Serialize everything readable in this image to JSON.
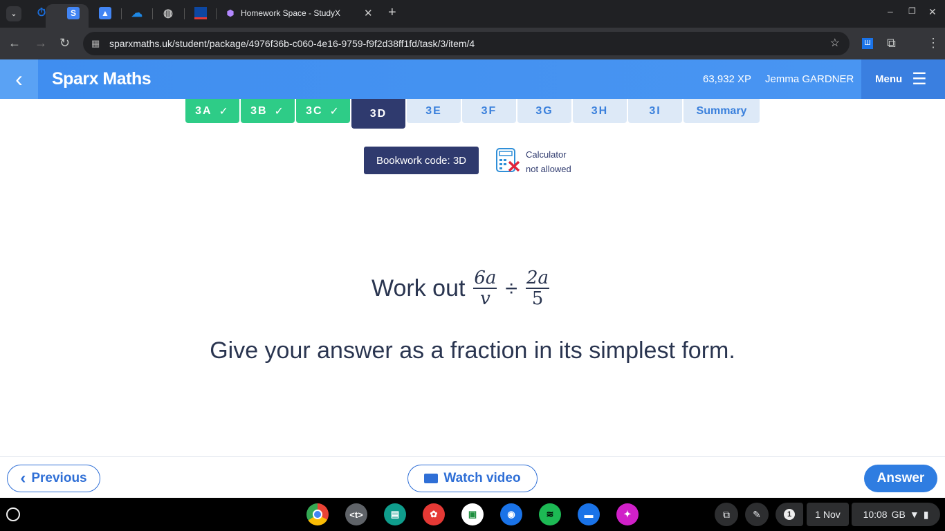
{
  "browser": {
    "tab_title": "Homework Space - StudyX",
    "url": "sparxmaths.uk/student/package/4976f36b-c060-4e16-9759-f9f2d38ff1fd/task/3/item/4",
    "favicon_s": "S"
  },
  "header": {
    "brand": "Sparx Maths",
    "xp": "63,932 XP",
    "user": "Jemma GARDNER",
    "menu": "Menu"
  },
  "tasks": [
    {
      "label": "3A",
      "done": true
    },
    {
      "label": "3B",
      "done": true
    },
    {
      "label": "3C",
      "done": true
    },
    {
      "label": "3D",
      "current": true
    },
    {
      "label": "3E"
    },
    {
      "label": "3F"
    },
    {
      "label": "3G"
    },
    {
      "label": "3H"
    },
    {
      "label": "3I"
    },
    {
      "label": "Summary"
    }
  ],
  "check": "✓",
  "bookwork": "Bookwork code: 3D",
  "calculator": {
    "line1": "Calculator",
    "line2": "not allowed"
  },
  "question": {
    "prefix": "Work out",
    "f1_num": "6a",
    "f1_den": "v",
    "op": "÷",
    "f2_num": "2a",
    "f2_den": "5",
    "instruction": "Give your answer as a fraction in its simplest form."
  },
  "footer": {
    "previous": "Previous",
    "watch": "Watch video",
    "answer": "Answer"
  },
  "shelf": {
    "notif": "1",
    "date": "1 Nov",
    "time": "10:08",
    "locale": "GB"
  },
  "colors": {
    "accent": "#3f8ef0",
    "done": "#2ecc87",
    "current": "#2f3a6e",
    "answer": "#2f7de1"
  }
}
